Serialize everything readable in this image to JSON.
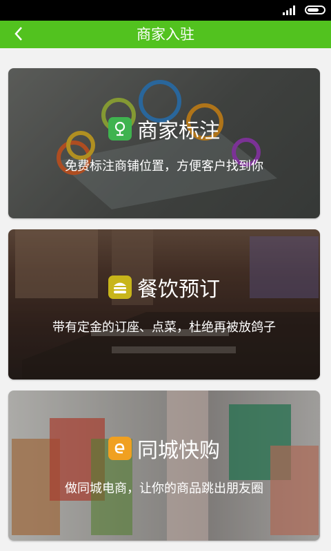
{
  "status_bar": {
    "signal_icon": "signal-strength-icon",
    "battery_icon": "battery-icon"
  },
  "header": {
    "title": "商家入驻",
    "back_icon": "back-chevron-icon",
    "color": "#52c21f"
  },
  "cards": [
    {
      "title": "商家标注",
      "description": "免费标注商铺位置，方便客户找到你",
      "icon": "location-pin-icon",
      "icon_color": "#3fb34f"
    },
    {
      "title": "餐饮预订",
      "description": "带有定金的订座、点菜，杜绝再被放鸽子",
      "icon": "burger-icon",
      "icon_color": "#c8b51a"
    },
    {
      "title": "同城快购",
      "description": "做同城电商，让你的商品跳出朋友圈",
      "icon": "e-shop-icon",
      "icon_color": "#f0a020"
    }
  ]
}
